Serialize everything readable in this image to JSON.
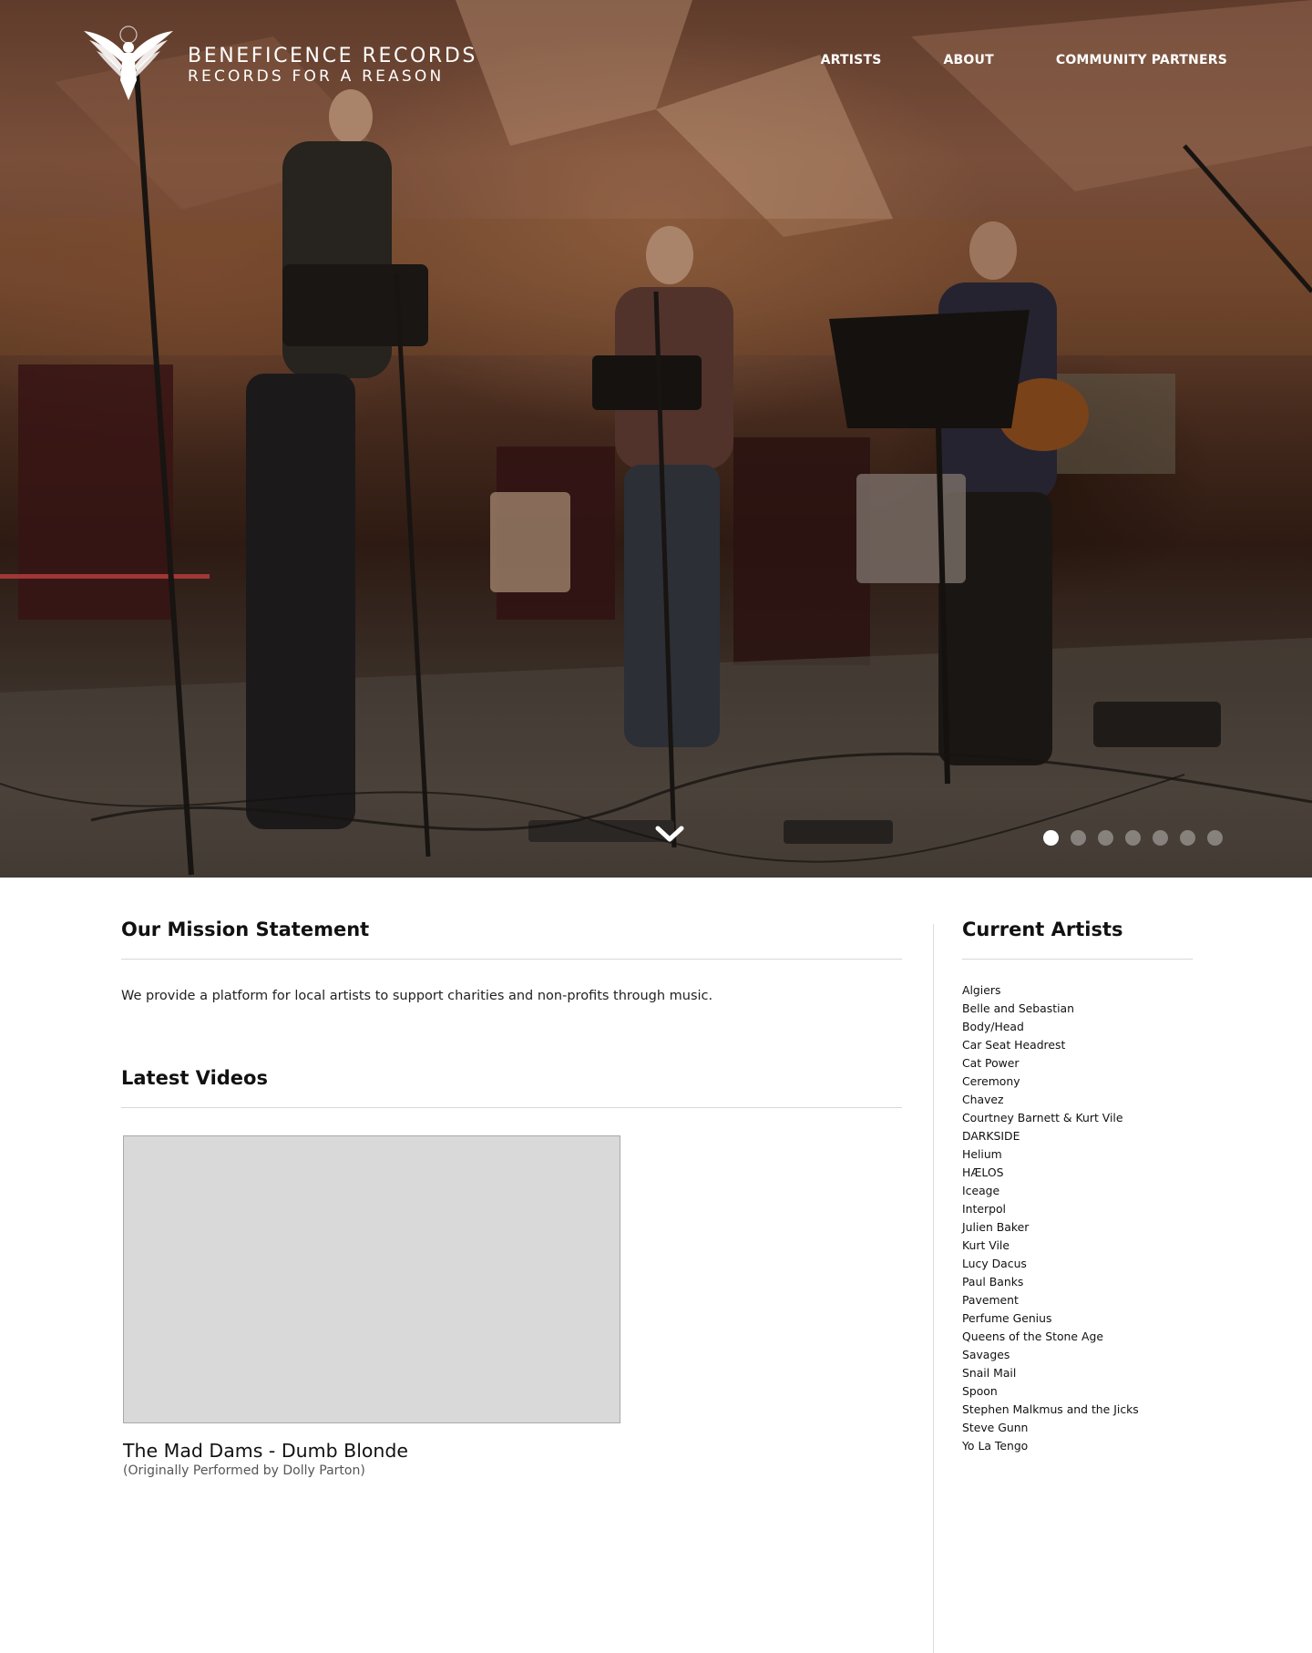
{
  "site": {
    "title": "BENEFICENCE RECORDS",
    "tagline": "RECORDS FOR A REASON",
    "brand_color": "#ffffff"
  },
  "nav": {
    "items": [
      {
        "label": "ARTISTS"
      },
      {
        "label": "ABOUT"
      },
      {
        "label": "COMMUNITY PARTNERS"
      }
    ]
  },
  "hero": {
    "slide_count": 7,
    "active_slide": 1,
    "scroll_icon": "chevron-down-icon"
  },
  "mission": {
    "heading": "Our Mission Statement",
    "text": "We provide a platform for local artists to support charities and non-profits through music."
  },
  "videos": {
    "heading": "Latest Videos",
    "items": [
      {
        "title": "The Mad Dams - Dumb Blonde",
        "subtitle": "(Originally Performed by Dolly Parton)"
      }
    ]
  },
  "sidebar": {
    "heading": "Current Artists",
    "artists": [
      "Algiers",
      "Belle and Sebastian",
      "Body/Head",
      "Car Seat Headrest",
      "Cat Power",
      "Ceremony",
      "Chavez",
      "Courtney Barnett & Kurt Vile",
      "DARKSIDE",
      "Helium",
      "HÆLOS",
      "Iceage",
      "Interpol",
      "Julien Baker",
      "Kurt Vile",
      "Lucy Dacus",
      "Paul Banks",
      "Pavement",
      "Perfume Genius",
      "Queens of the Stone Age",
      "Savages",
      "Snail Mail",
      "Spoon",
      "Stephen Malkmus and the Jicks",
      "Steve Gunn",
      "Yo La Tengo"
    ]
  }
}
